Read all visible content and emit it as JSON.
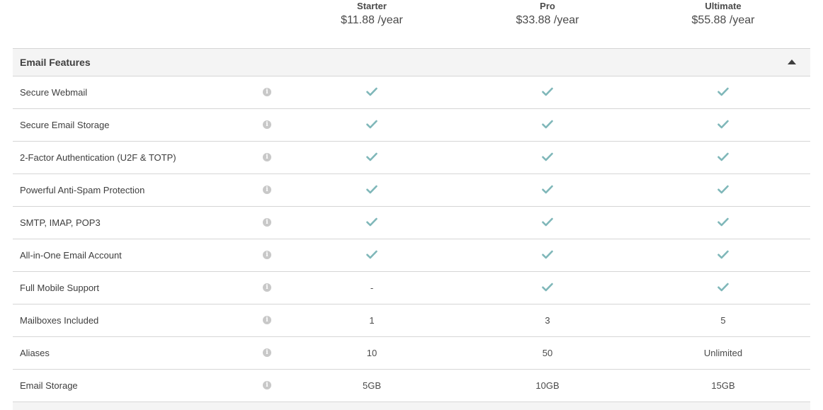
{
  "plans": [
    {
      "name": "Starter",
      "price": "$11.88 /year"
    },
    {
      "name": "Pro",
      "price": "$33.88 /year"
    },
    {
      "name": "Ultimate",
      "price": "$55.88 /year"
    }
  ],
  "section": {
    "title": "Email Features"
  },
  "colors": {
    "check": "#7fb7b9",
    "info": "#c8c8c8",
    "header_bg": "#f4f4f4"
  },
  "rows": [
    {
      "feature": "Secure Webmail",
      "values": [
        "check",
        "check",
        "check"
      ]
    },
    {
      "feature": "Secure Email Storage",
      "values": [
        "check",
        "check",
        "check"
      ]
    },
    {
      "feature": "2-Factor Authentication (U2F & TOTP)",
      "values": [
        "check",
        "check",
        "check"
      ]
    },
    {
      "feature": "Powerful Anti-Spam Protection",
      "values": [
        "check",
        "check",
        "check"
      ]
    },
    {
      "feature": "SMTP, IMAP, POP3",
      "values": [
        "check",
        "check",
        "check"
      ]
    },
    {
      "feature": "All-in-One Email Account",
      "values": [
        "check",
        "check",
        "check"
      ]
    },
    {
      "feature": "Full Mobile Support",
      "values": [
        "-",
        "check",
        "check"
      ]
    },
    {
      "feature": "Mailboxes Included",
      "values": [
        "1",
        "3",
        "5"
      ]
    },
    {
      "feature": "Aliases",
      "values": [
        "10",
        "50",
        "Unlimited"
      ]
    },
    {
      "feature": "Email Storage",
      "values": [
        "5GB",
        "10GB",
        "15GB"
      ]
    }
  ]
}
